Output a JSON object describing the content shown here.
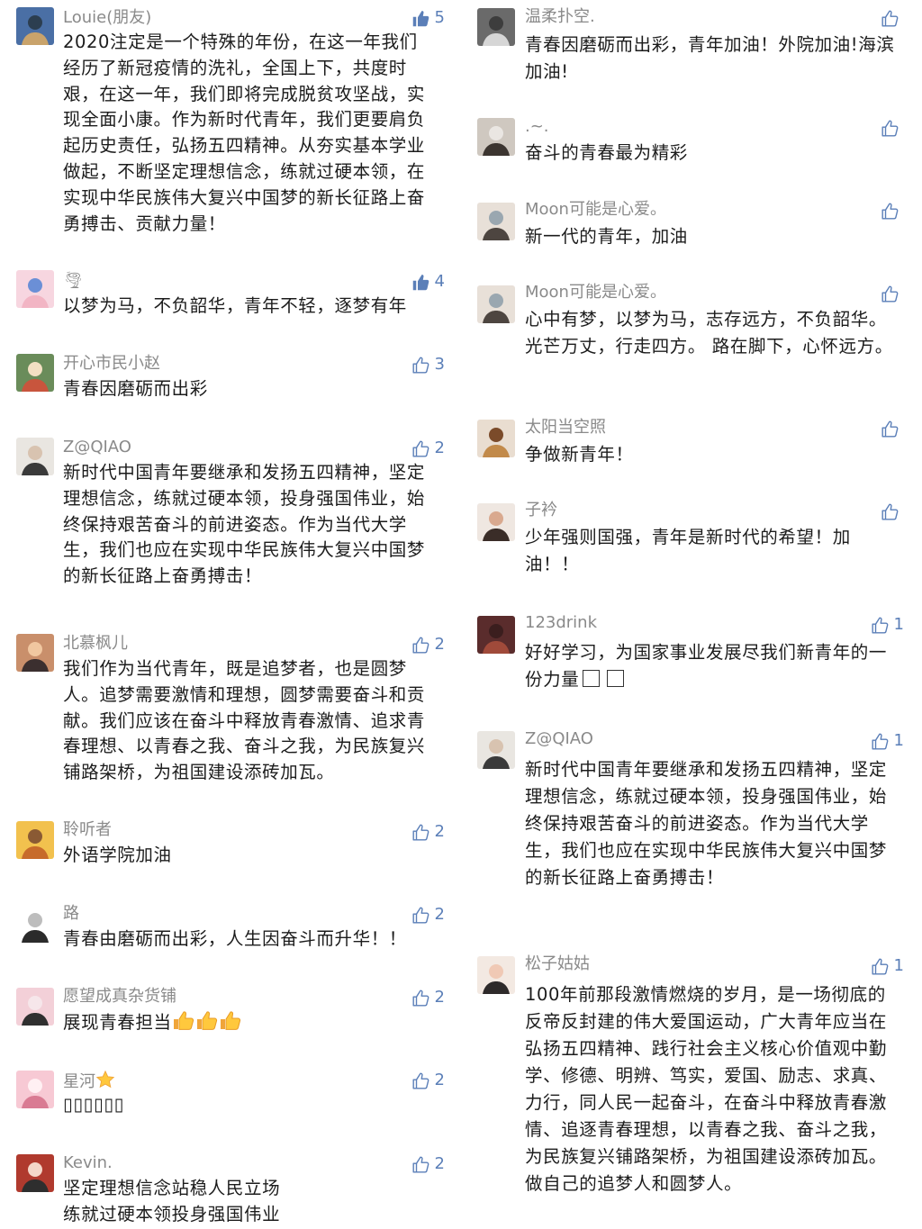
{
  "left": [
    {
      "nick": "Louie(朋友)",
      "likes": "5",
      "liked": true,
      "text": "2020注定是一个特殊的年份，在这一年我们经历了新冠疫情的洗礼，全国上下，共度时艰，在这一年，我们即将完成脱贫攻坚战，实现全面小康。作为新时代青年，我们更要肩负起历史责任，弘扬五四精神。从夯实基本学业做起，不断坚定理想信念，练就过硬本领，在实现中华民族伟大复兴中国梦的新长征路上奋勇搏击、贡献力量！"
    },
    {
      "nick": "🌪",
      "likes": "4",
      "liked": true,
      "text": "以梦为马，不负韶华，青年不轻，逐梦有年"
    },
    {
      "nick": "开心市民小赵",
      "likes": "3",
      "liked": false,
      "text": "青春因磨砺而出彩"
    },
    {
      "nick": "Z@QIAO",
      "likes": "2",
      "liked": false,
      "text": "新时代中国青年要继承和发扬五四精神，坚定理想信念，练就过硬本领，投身强国伟业，始终保持艰苦奋斗的前进姿态。作为当代大学生，我们也应在实现中华民族伟大复兴中国梦的新长征路上奋勇搏击！"
    },
    {
      "nick": "北慕枫儿",
      "likes": "2",
      "liked": false,
      "text": "我们作为当代青年，既是追梦者，也是圆梦人。追梦需要激情和理想，圆梦需要奋斗和贡献。我们应该在奋斗中释放青春激情、追求青春理想、以青春之我、奋斗之我，为民族复兴铺路架桥，为祖国建设添砖加瓦。"
    },
    {
      "nick": "聆听者",
      "likes": "2",
      "liked": false,
      "text": "外语学院加油"
    },
    {
      "nick": "路",
      "likes": "2",
      "liked": false,
      "text": "青春由磨砺而出彩，人生因奋斗而升华！！"
    },
    {
      "nick": "愿望成真杂货铺",
      "likes": "2",
      "liked": false,
      "text": "展现青春担当"
    },
    {
      "nick": "星河",
      "likes": "2",
      "liked": false,
      "text": "▯▯▯▯▯▯"
    },
    {
      "nick": "Kevin.",
      "likes": "2",
      "liked": false,
      "text_lines": [
        "坚定理想信念站稳人民立场",
        "练就过硬本领投身强国伟业"
      ]
    }
  ],
  "right": [
    {
      "nick": "温柔扑空.",
      "likes": "",
      "text": "青春因磨砺而出彩，青年加油！外院加油!海滨加油!"
    },
    {
      "nick": ".~.",
      "likes": "",
      "text": "奋斗的青春最为精彩"
    },
    {
      "nick": "Moon可能是心爱。",
      "likes": "",
      "text": "新一代的青年，加油"
    },
    {
      "nick": "Moon可能是心爱。",
      "likes": "",
      "text": "心中有梦，以梦为马，志存远方，不负韶华。 光芒万丈，行走四方。 路在脚下，心怀远方。"
    },
    {
      "nick": "太阳当空照",
      "likes": "",
      "text": "争做新青年！"
    },
    {
      "nick": "子衿",
      "likes": "",
      "text": "少年强则国强，青年是新时代的希望！加油！！"
    },
    {
      "nick": "123drink",
      "likes": "1",
      "text": "好好学习，为国家事业发展尽我们新青年的一份力量"
    },
    {
      "nick": "Z@QIAO",
      "likes": "1",
      "text": "新时代中国青年要继承和发扬五四精神，坚定理想信念，练就过硬本领，投身强国伟业，始终保持艰苦奋斗的前进姿态。作为当代大学生，我们也应在实现中华民族伟大复兴中国梦的新长征路上奋勇搏击！"
    },
    {
      "nick": "松子姑姑",
      "likes": "1",
      "text": "100年前那段激情燃烧的岁月，是一场彻底的反帝反封建的伟大爱国运动，广大青年应当在弘扬五四精神、践行社会主义核心价值观中勤学、修德、明辨、笃实，爱国、励志、求真、力行，同人民一起奋斗，在奋斗中释放青春激情、追逐青春理想，以青春之我、奋斗之我，为民族复兴铺路架桥，为祖国建设添砖加瓦。做自己的追梦人和圆梦人。"
    }
  ]
}
